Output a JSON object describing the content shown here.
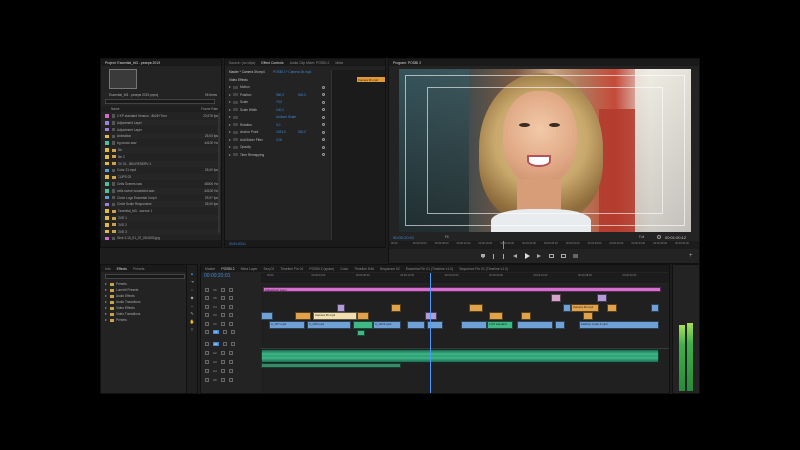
{
  "project": {
    "header": "Project: Essential_fd3 - резерв 2019",
    "thumb_caption": "Essential_fd3 - резерв 2019.prproj",
    "count": "96 items",
    "col_name": "Name",
    "col_rate": "Frame Rate",
    "items": [
      {
        "name": "2 KP standard Version - 8b26+Turn",
        "rate": "23,976 fps",
        "color": "#cf6ec8",
        "bin": false
      },
      {
        "name": "Adjustment Layer",
        "rate": "",
        "color": "#9a82d8",
        "bin": false
      },
      {
        "name": "Adjustment Layer",
        "rate": "",
        "color": "#9a82d8",
        "bin": false
      },
      {
        "name": "Animation",
        "rate": "25,00 fps",
        "color": "#e0b94a",
        "bin": false
      },
      {
        "name": "bg-music.wav",
        "rate": "44100 Hz",
        "color": "#4fbf9e",
        "bin": false
      },
      {
        "name": "Bin",
        "rate": "",
        "color": "#e0b94a",
        "bin": true
      },
      {
        "name": "Bin 2",
        "rate": "",
        "color": "#e0b94a",
        "bin": true
      },
      {
        "name": "DV 01 - BIN RESERV 1",
        "rate": "",
        "color": "#e0b94a",
        "bin": true
      },
      {
        "name": "Color 21.mp4",
        "rate": "25,00 fps",
        "color": "#5aa0d8",
        "bin": false
      },
      {
        "name": "CLIPS 02",
        "rate": "",
        "color": "#e0b94a",
        "bin": true
      },
      {
        "name": "Cells Scenes.wav",
        "rate": "48000 Hz",
        "color": "#4fbf9e",
        "bin": false
      },
      {
        "name": "cells scene woodwind.wav",
        "rate": "44100 Hz",
        "color": "#4fbf9e",
        "bin": false
      },
      {
        "name": "Circle Logo Essential 3.mp4",
        "rate": "29,97 fps",
        "color": "#5aa0d8",
        "bin": false
      },
      {
        "name": "Circle Scale Responsive",
        "rate": "25,00 fps",
        "color": "#9a82d8",
        "bin": false
      },
      {
        "name": "Essential_fd3 - чистое 1",
        "rate": "",
        "color": "#e0b94a",
        "bin": true
      },
      {
        "name": "DVD 1",
        "rate": "",
        "color": "#e0b94a",
        "bin": true
      },
      {
        "name": "DVD 2",
        "rate": "",
        "color": "#e0b94a",
        "bin": true
      },
      {
        "name": "DVD 3",
        "rate": "",
        "color": "#e0b94a",
        "bin": true
      },
      {
        "name": "Give 2.10_01_07_05.0000.jpg",
        "rate": "",
        "color": "#cf6ec8",
        "bin": false
      }
    ]
  },
  "effect_controls": {
    "tabs": [
      "Source: (no clips)",
      "Effect Controls",
      "Audio Clip Mixer: POSBI 2",
      "Meta"
    ],
    "active_tab": 1,
    "source_label": "Master * Camera 3h.mp4",
    "clip_label": "POSBI 2 * Camera 3h.mp4",
    "clip_bar_label": "Camera 3h.mp4",
    "section_video": "Video Effects",
    "rows": [
      {
        "label": "Motion",
        "v1": "",
        "v2": ""
      },
      {
        "label": "Position",
        "v1": "960,0",
        "v2": "540,0"
      },
      {
        "label": "Scale",
        "v1": "79,0",
        "v2": ""
      },
      {
        "label": "Scale Width",
        "v1": "100,0",
        "v2": ""
      },
      {
        "label": "",
        "v1": "Uniform Scale",
        "v2": ""
      },
      {
        "label": "Rotation",
        "v1": "0,0",
        "v2": ""
      },
      {
        "label": "Anchor Point",
        "v1": "1024,0",
        "v2": "540,0"
      },
      {
        "label": "Anti-flicker Filter",
        "v1": "0,00",
        "v2": ""
      },
      {
        "label": "Opacity",
        "v1": "",
        "v2": ""
      },
      {
        "label": "Time Remapping",
        "v1": "",
        "v2": ""
      }
    ],
    "timecode": "00:00:20:01"
  },
  "program": {
    "title": "Program: POSBI 2",
    "timecode_left": "00:00:20:01",
    "fit": "Fit",
    "full": "Full",
    "timecode_right": "00:01:00:12",
    "ruler": [
      "00:00",
      "00:00:04:00",
      "00:00:08:00",
      "00:00:12:00",
      "00:00:16:00",
      "00:00:20:00",
      "00:00:24:00",
      "00:00:28:00",
      "00:00:32:00",
      "00:00:36:00",
      "00:00:40:00",
      "00:00:44:00",
      "00:00:48:00",
      "00:00:52:00"
    ]
  },
  "effects": {
    "tabs": [
      "Info",
      "Effects",
      "Presets"
    ],
    "active_tab": 1,
    "folders": [
      "Presets",
      "Lumetri Presets",
      "Audio Effects",
      "Audio Transitions",
      "Video Effects",
      "Video Transitions",
      "Presets"
    ]
  },
  "timeline": {
    "tabs": [
      "Master",
      "POSBI 2",
      "Meta Layer",
      "Seq 02",
      "Timeline Fin 01",
      "POSBI 2 (spare)",
      "Color",
      "Timeline Edit",
      "Sequence 02",
      "Essential Fin 01 (Timeline v1.0)",
      "Sequence Fin 01 (Timeline v1.0)"
    ],
    "active_tab": 1,
    "timecode": "00:00:20:01",
    "ruler": [
      "00:00",
      "00:00:04:00",
      "00:00:08:00",
      "00:00:12:00",
      "00:00:16:00",
      "00:00:20:00",
      "00:00:24:00",
      "00:00:28:00",
      "00:00:32:00"
    ],
    "tracks": [
      "V6",
      "V5",
      "V4",
      "V3",
      "V2",
      "V1",
      "A1",
      "A2",
      "A3",
      "A4",
      "A5"
    ],
    "clip_labels": {
      "adjustment": "Adjustment Layer",
      "camera": "Camera 3h.mp4",
      "c_a": "C_Ch7.mp4",
      "c_b": "C_Ch8.mp4",
      "c_c": "C_Ch10.mp4",
      "kp": "2 KP standard",
      "camera2": "Camera 3h.mp4",
      "fashion": "Fashion music 2.mp4",
      "give": "Give 2"
    }
  },
  "colors": {
    "accent": "#3d8ad6",
    "playhead": "#4a9bff",
    "audio": "#3fb886",
    "pink": "#d66fcf",
    "video": "#6fa0d6",
    "orange": "#e0a24a",
    "purple": "#b59ad8"
  }
}
